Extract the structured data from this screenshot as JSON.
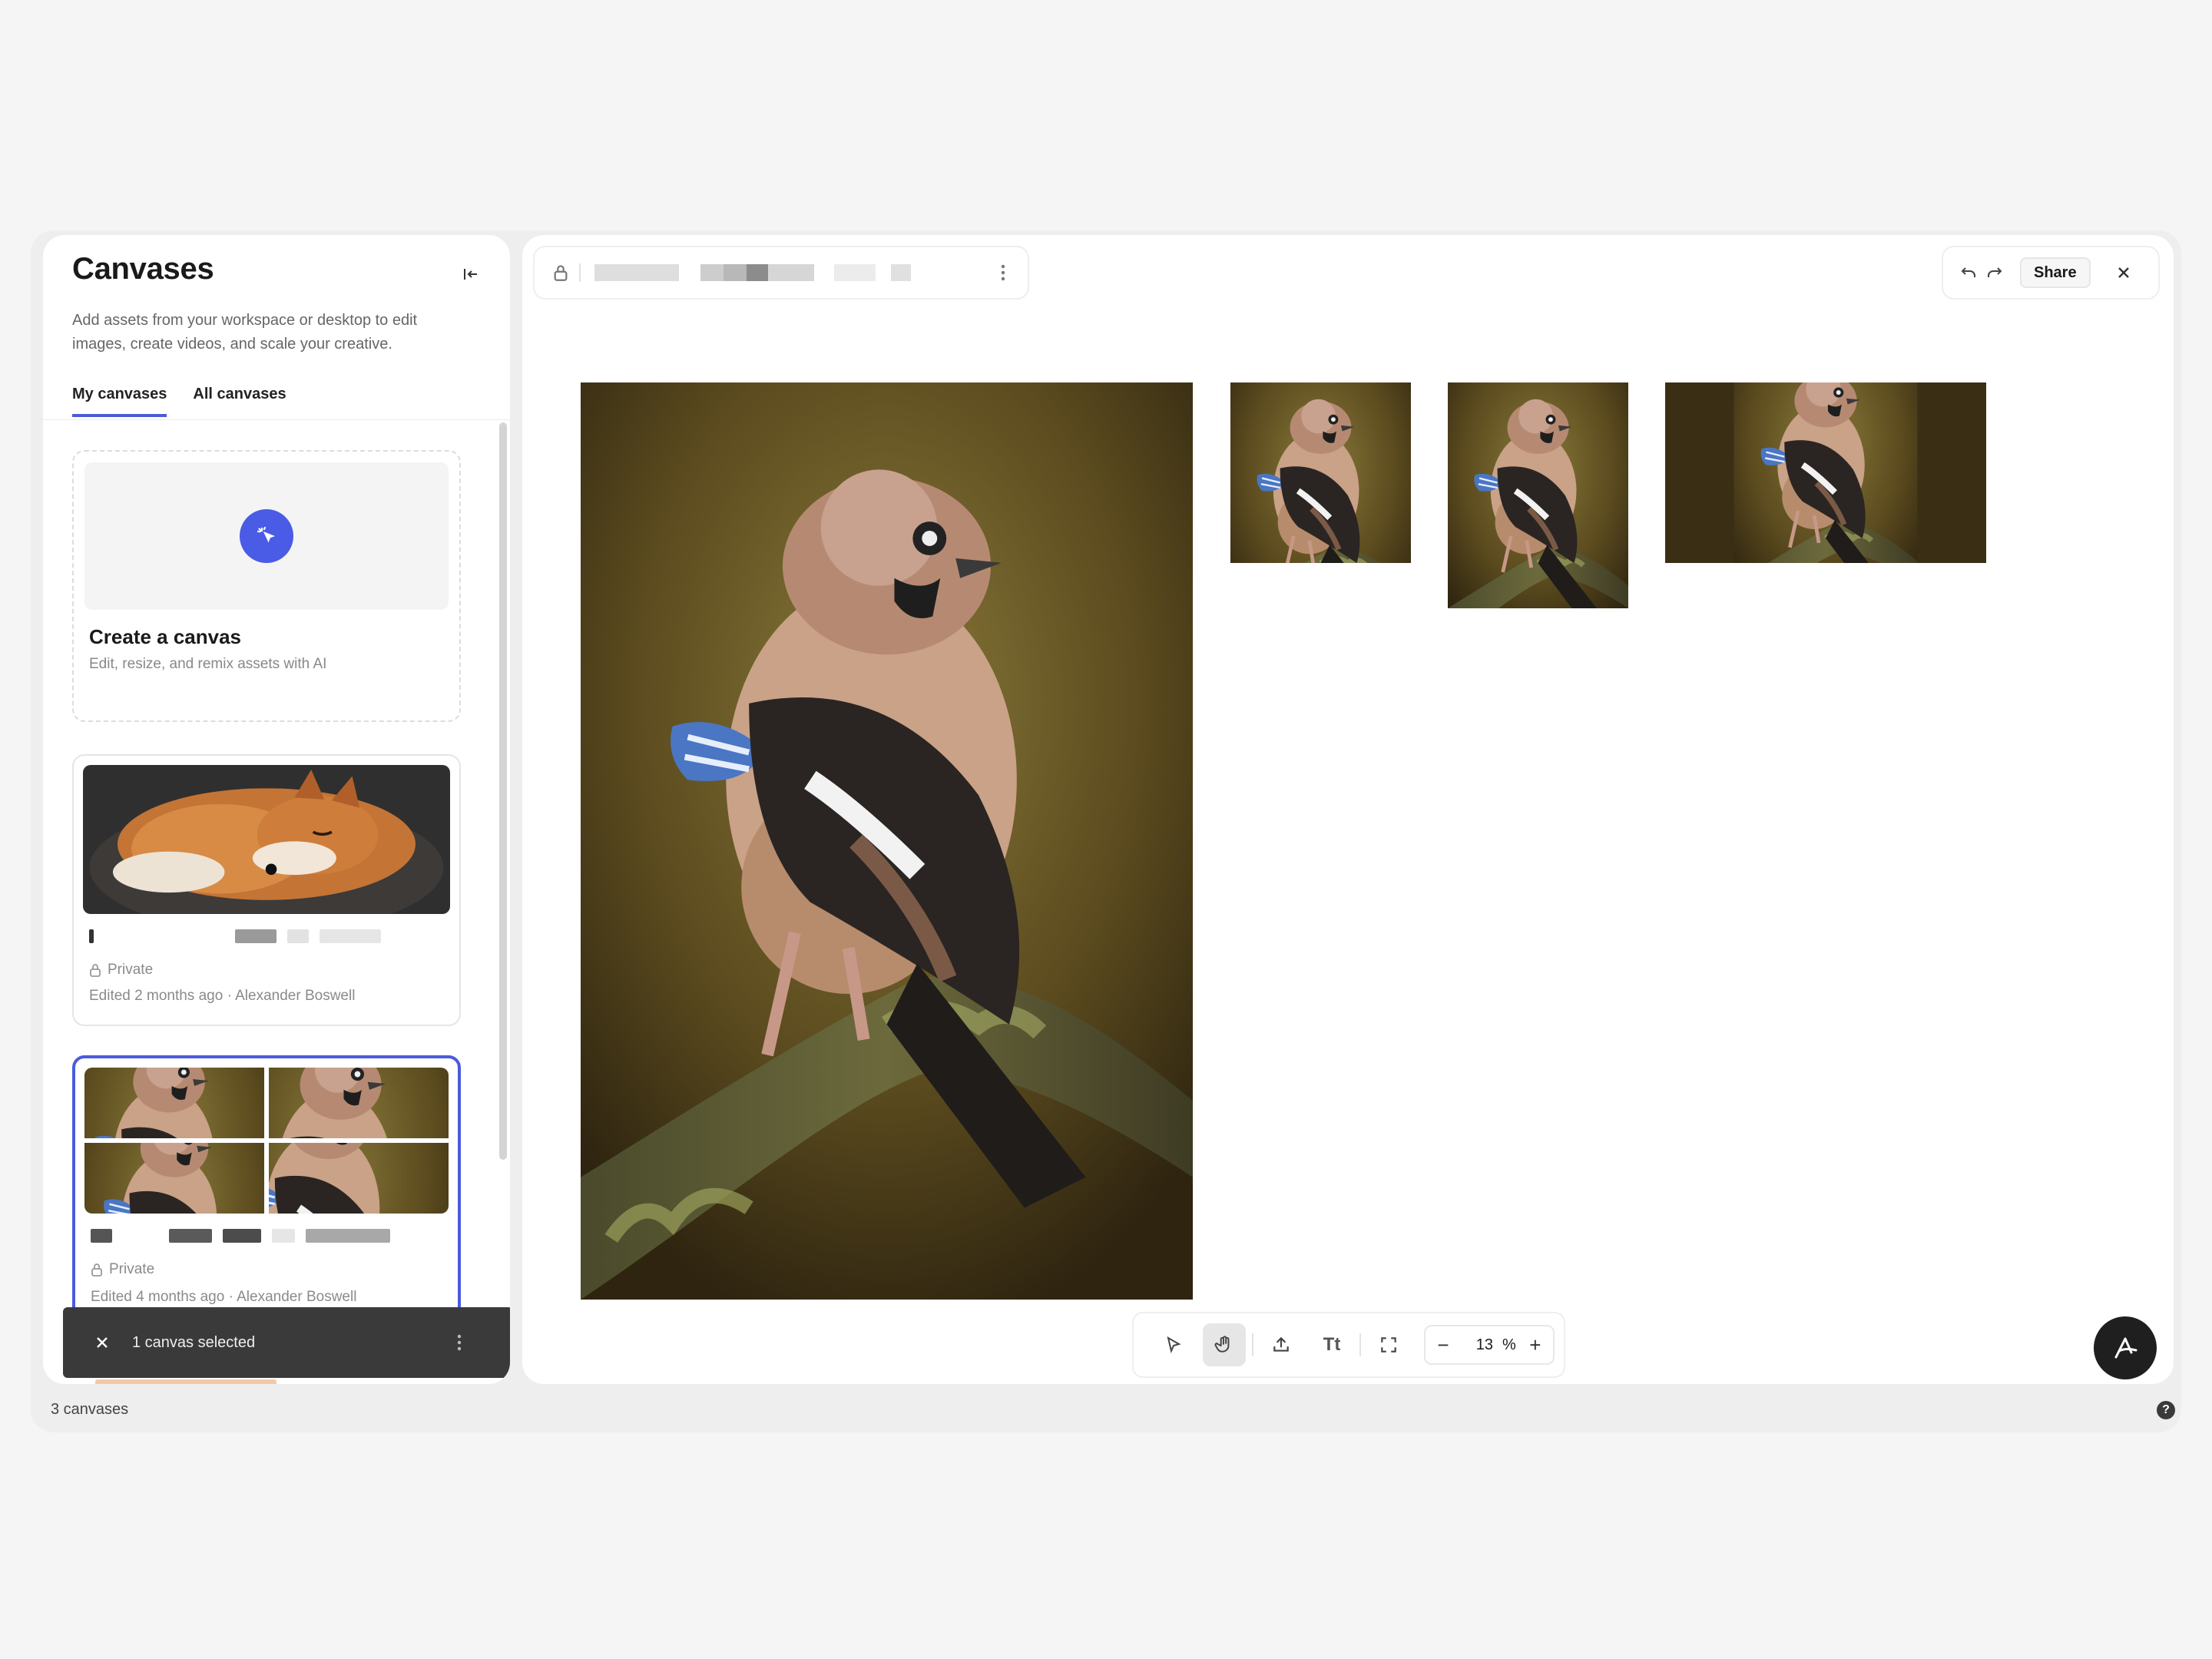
{
  "sidebar": {
    "title": "Canvases",
    "description": "Add assets from your workspace or desktop to edit images, create videos, and scale your creative.",
    "tabs": [
      {
        "label": "My canvases"
      },
      {
        "label": "All canvases"
      }
    ],
    "create_card": {
      "title": "Create a canvas",
      "subtitle": "Edit, resize, and remix assets with AI"
    },
    "canvases": [
      {
        "visibility": "Private",
        "edited": "Edited 2 months ago · Alexander Boswell",
        "thumbnail": "sleeping-fox"
      },
      {
        "visibility": "Private",
        "edited": "Edited 4 months ago · Alexander Boswell",
        "thumbnail": "jay-grid"
      }
    ]
  },
  "selection_toast": {
    "text": "1 canvas selected"
  },
  "status_bar": {
    "count": "3 canvases",
    "help": "?"
  },
  "topbar": {
    "share_label": "Share"
  },
  "toolbar": {
    "text_tool_label": "Tt",
    "zoom_value": "13",
    "zoom_unit": "%",
    "zoom_minus": "−",
    "zoom_plus": "+"
  },
  "colors": {
    "accent": "#4b5bdc",
    "toast_bg": "#3a3a3a",
    "ai_button": "#1f1f1f"
  },
  "icons": [
    "collapse-sidebar-icon",
    "sparkle-cursor-icon",
    "lock-icon",
    "more-vertical-icon",
    "undo-icon",
    "redo-icon",
    "close-icon",
    "select-arrow-icon",
    "hand-icon",
    "upload-icon",
    "text-icon",
    "fit-screen-icon",
    "ai-assistant-icon",
    "help-icon"
  ]
}
